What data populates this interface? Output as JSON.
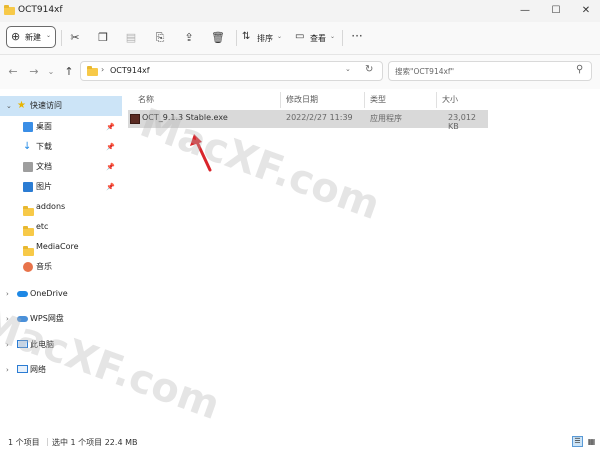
{
  "window": {
    "title": "OCT914xf"
  },
  "toolbar": {
    "new_label": "新建",
    "sort_label": "排序",
    "view_label": "查看"
  },
  "address": {
    "path": "OCT914xf",
    "search_placeholder": "搜索\"OCT914xf\""
  },
  "sidebar": {
    "quick_access": "快速访问",
    "items": [
      {
        "label": "桌面"
      },
      {
        "label": "下载"
      },
      {
        "label": "文档"
      },
      {
        "label": "图片"
      },
      {
        "label": "addons"
      },
      {
        "label": "etc"
      },
      {
        "label": "MediaCore"
      },
      {
        "label": "音乐"
      }
    ],
    "onedrive": "OneDrive",
    "wps": "WPS网盘",
    "this_pc": "此电脑",
    "network": "网络"
  },
  "columns": {
    "name": "名称",
    "date": "修改日期",
    "type": "类型",
    "size": "大小"
  },
  "files": [
    {
      "name": "OCT_9.1.3 Stable.exe",
      "date": "2022/2/27 11:39",
      "type": "应用程序",
      "size": "23,012 KB"
    }
  ],
  "status": {
    "count": "1 个项目",
    "selected": "选中 1 个项目 22.4 MB"
  },
  "watermark": {
    "text": "MacXF.com"
  },
  "colors": {
    "folder": "#f7c948",
    "selection": "#cce4f7",
    "arrow": "#d9252b"
  }
}
